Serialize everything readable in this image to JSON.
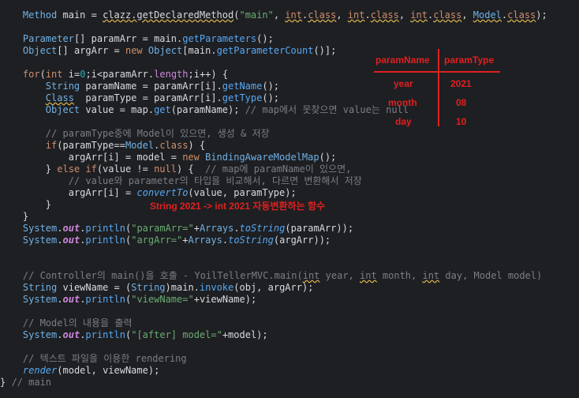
{
  "code_lines": [
    "    Method main = clazz.getDeclaredMethod(\"main\", int.class, int.class, int.class, Model.class);",
    "",
    "    Parameter[] paramArr = main.getParameters();",
    "    Object[] argArr = new Object[main.getParameterCount()];",
    "",
    "    for(int i=0;i<paramArr.length;i++) {",
    "        String paramName = paramArr[i].getName();",
    "        Class  paramType = paramArr[i].getType();",
    "        Object value = map.get(paramName); // map에서 못찾으면 value는 null",
    "",
    "        // paramType중에 Model이 있으면, 생성 & 저장",
    "        if(paramType==Model.class) {",
    "            argArr[i] = model = new BindingAwareModelMap();",
    "        } else if(value != null) {  // map에 paramName이 있으면,",
    "            // value와 parameter의 타입을 비교해서, 다르면 변환해서 저장",
    "            argArr[i] = convertTo(value, paramType);",
    "        }",
    "    }",
    "    System.out.println(\"paramArr=\"+Arrays.toString(paramArr));",
    "    System.out.println(\"argArr=\"+Arrays.toString(argArr));",
    "",
    "",
    "    // Controller의 main()을 호출 - YoilTellerMVC.main(int year, int month, int day, Model model)",
    "    String viewName = (String)main.invoke(obj, argArr);",
    "    System.out.println(\"viewName=\"+viewName);",
    "",
    "    // Model의 내용을 출력",
    "    System.out.println(\"[after] model=\"+model);",
    "",
    "    // 텍스트 파일을 이용한 rendering",
    "    render(model, viewName);",
    "} // main"
  ],
  "annotation": {
    "header": [
      "paramName",
      "paramType"
    ],
    "rows": [
      [
        "year",
        "2021"
      ],
      [
        "month",
        "08"
      ],
      [
        "day",
        "10"
      ]
    ],
    "conversion_note": "String 2021 -> int 2021 자동변환하는 함수",
    "color": "#e02020"
  }
}
